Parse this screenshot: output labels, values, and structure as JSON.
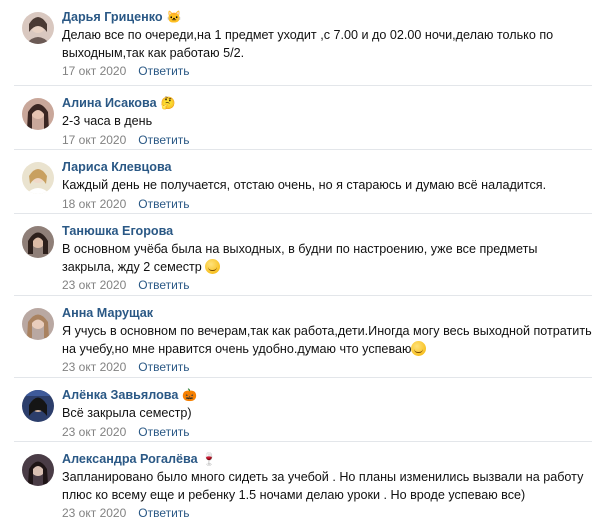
{
  "comments": [
    {
      "author": "Дарья Гриценко",
      "badge_icon": "cat-emoji",
      "text": "Делаю все по очереди,на 1 предмет уходит ,с 7.00 и до 02.00 ночи,делаю только по выходным,так как работаю 5/2.",
      "date": "17 окт 2020",
      "reply": "Ответить"
    },
    {
      "author": "Алина Исакова",
      "badge_icon": "thinking-face-emoji",
      "text": "2-3 часа в день",
      "date": "17 окт 2020",
      "reply": "Ответить"
    },
    {
      "author": "Лариса Клевцова",
      "badge_icon": "",
      "text": "Каждый день не получается, отстаю очень, но я стараюсь и думаю всё наладится.",
      "date": "18 окт 2020",
      "reply": "Ответить"
    },
    {
      "author": "Танюшка Егорова",
      "badge_icon": "",
      "text": "В основном учёба была на выходных, в будни по настроению, уже все предметы закрыла, жду 2 семестр",
      "text_emoji": "smiling-face-emoji",
      "date": "23 окт 2020",
      "reply": "Ответить"
    },
    {
      "author": "Анна Марущак",
      "badge_icon": "",
      "text": "Я учусь в основном по вечерам,так как работа,дети.Иногда могу весь выходной потратить на учебу,но мне нравится очень удобно.думаю что успеваю",
      "text_emoji": "winking-face-emoji",
      "date": "23 окт 2020",
      "reply": "Ответить"
    },
    {
      "author": "Алёнка Завьялова",
      "badge_icon": "pumpkin-emoji",
      "text": "Всё закрыла семестр)",
      "date": "23 окт 2020",
      "reply": "Ответить"
    },
    {
      "author": "Александра Рогалёва",
      "badge_icon": "wine-glass-emoji",
      "text": "Запланировано было много сидеть за учебой . Но планы изменились вызвали на работу плюс ко всему еще и ребенку 1.5 ночами делаю уроки . Но вроде успеваю все)",
      "date": "23 окт 2020",
      "reply": "Ответить"
    }
  ],
  "colors": {
    "author": "#2a5885",
    "date": "#828282",
    "separator": "#e3e6ea"
  }
}
